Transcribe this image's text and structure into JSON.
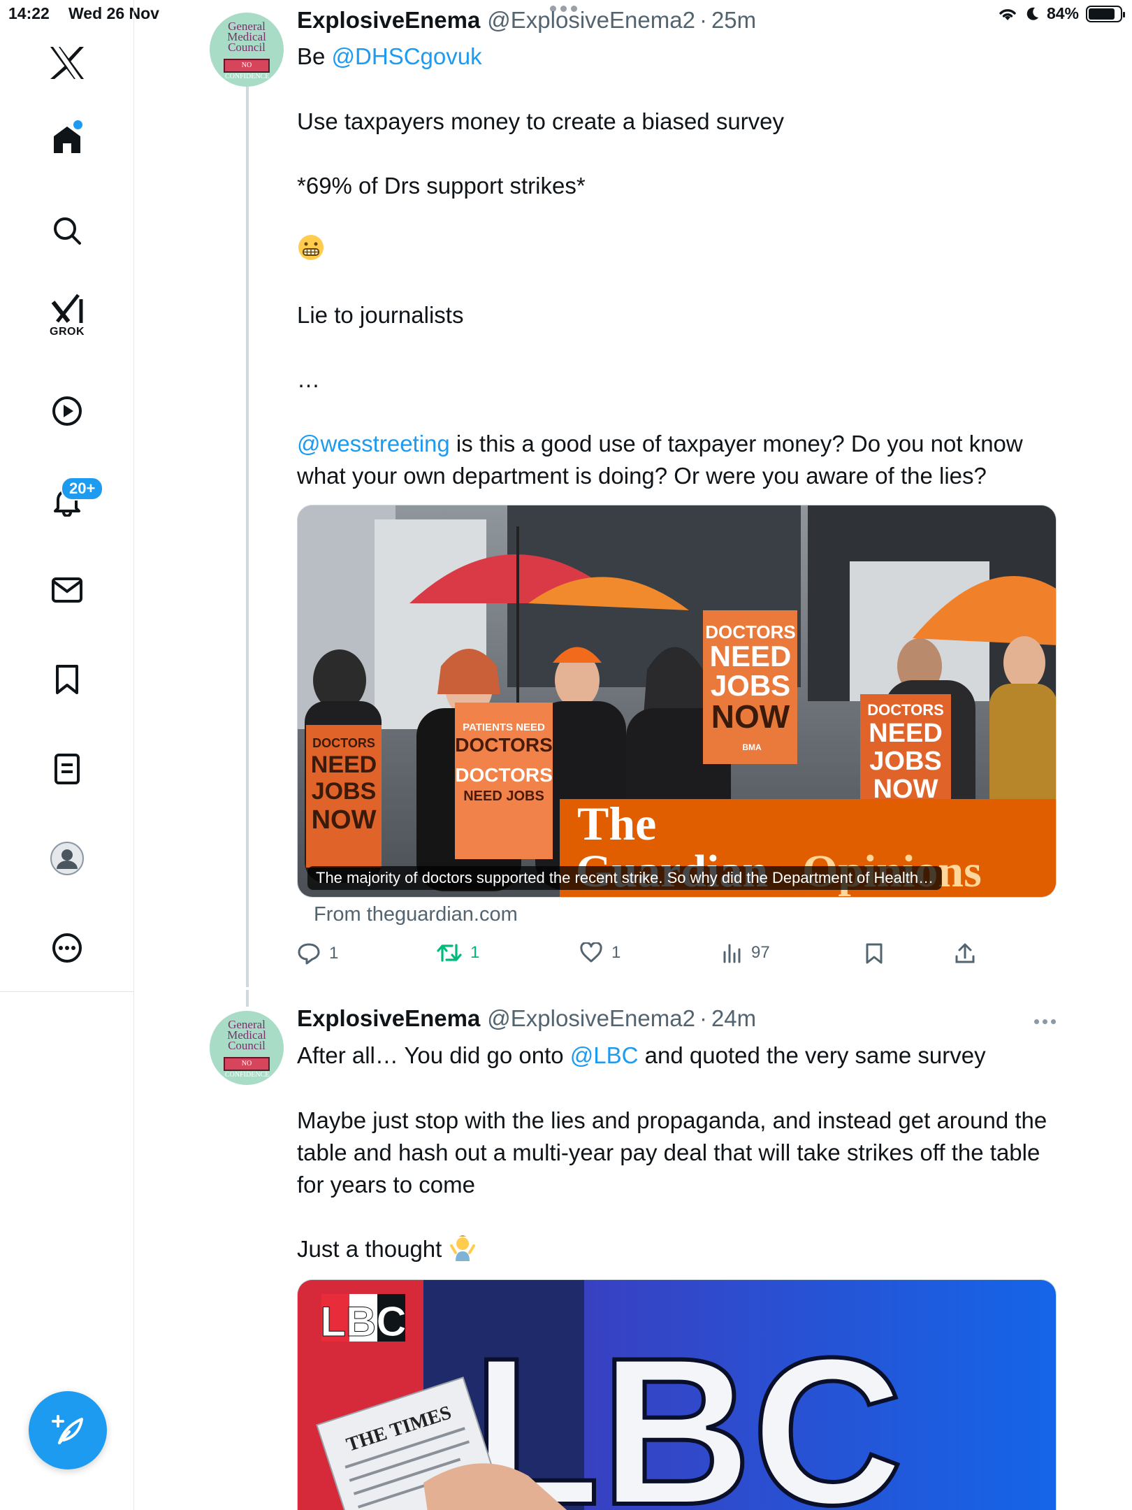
{
  "status_bar": {
    "time": "14:22",
    "date": "Wed 26 Nov",
    "battery": "84%",
    "battery_level": 0.84
  },
  "sidebar": {
    "grok_label": "GROK",
    "notifications_badge": "20+",
    "items": [
      "x-logo",
      "home",
      "search",
      "grok",
      "video",
      "notifications",
      "messages",
      "bookmarks",
      "lists",
      "profile",
      "more"
    ]
  },
  "tweets": [
    {
      "name": "ExplosiveEnema",
      "handle": "@ExplosiveEnema2",
      "time": "25m",
      "avatar_text": [
        "General",
        "Medical",
        "Council"
      ],
      "avatar_badge": "NO CONFIDENCE",
      "line1_prefix": "Be ",
      "line1_mention": "@DHSCgovuk",
      "p2": "Use taxpayers money to create a biased survey",
      "p3": "*69% of Drs support strikes*",
      "p4": "Lie to journalists",
      "p5": "…",
      "p6_mention": "@wesstreeting",
      "p6_text": " is this a good use of taxpayer money? Do you not know what your own department is doing? Or were you aware of the lies?",
      "card_caption": "The majority of doctors supported the recent strike. So why did the Department of Health…",
      "card_source": "From theguardian.com",
      "card_brand_1": "The",
      "card_brand_2": "Guardian",
      "card_brand_3": "Opinions",
      "signs": {
        "a": [
          "DOCTORS",
          "NEED",
          "JOBS",
          "NOW"
        ],
        "b": [
          "PATIENTS NEED",
          "DOCTORS",
          "DOCTORS",
          "NEED JOBS"
        ],
        "c": [
          "DOCTORS",
          "NEED",
          "JOBS",
          "NOW"
        ],
        "d": [
          "DOCTORS",
          "NEED",
          "JOBS",
          "NOW"
        ],
        "bma": "BMA"
      },
      "replies": "1",
      "reposts": "1",
      "likes": "1",
      "views": "97"
    },
    {
      "name": "ExplosiveEnema",
      "handle": "@ExplosiveEnema2",
      "time": "24m",
      "avatar_text": [
        "General",
        "Medical",
        "Council"
      ],
      "avatar_badge": "NO CONFIDENCE",
      "p1_prefix": "After all… You did go onto ",
      "p1_mention": "@LBC",
      "p1_suffix": " and quoted the very same survey",
      "p2": "Maybe just stop with the lies and propaganda, and instead get around the table and hash out a multi-year pay deal that will take strikes off the table for years to come",
      "p3": "Just a thought",
      "media_logo": "LBC",
      "media_big": "LBC",
      "media_paper": "THE TIMES"
    }
  ],
  "colors": {
    "accent": "#1d9bf0",
    "repost_green": "#00ba7c",
    "secondary_text": "#536471",
    "guardian_orange": "#e05e00"
  }
}
